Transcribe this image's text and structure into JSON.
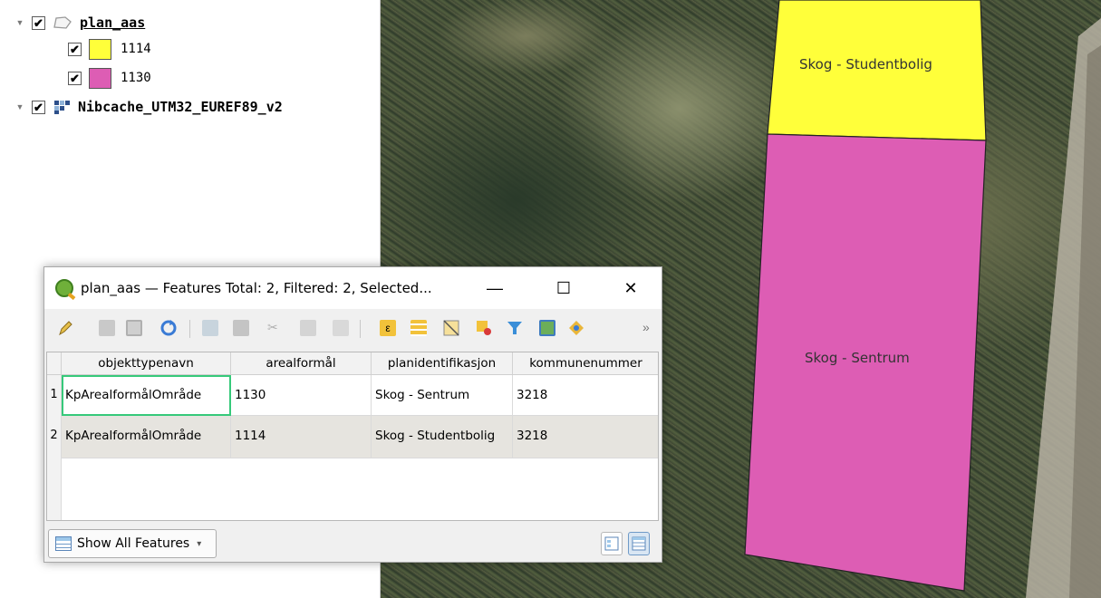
{
  "layers_panel": {
    "layers": [
      {
        "name": "plan_aas",
        "checked": true,
        "icon": "polygon-layer-icon",
        "legend": [
          {
            "label": "1114",
            "color": "#ffff3a",
            "checked": true
          },
          {
            "label": "1130",
            "color": "#dd5db4",
            "checked": true
          }
        ]
      },
      {
        "name": "Nibcache_UTM32_EUREF89_v2",
        "checked": true,
        "icon": "raster-layer-icon"
      }
    ]
  },
  "map": {
    "zones": [
      {
        "label": "Skog - Studentbolig",
        "color": "#ffff3a"
      },
      {
        "label": "Skog - Sentrum",
        "color": "#dd5db4"
      }
    ]
  },
  "attribute_table": {
    "title": "plan_aas — Features Total: 2, Filtered: 2, Selected...",
    "window_controls": {
      "minimize": "—",
      "maximize": "☐",
      "close": "✕"
    },
    "toolbar_overflow": "»",
    "columns": [
      "objekttypenavn",
      "arealformål",
      "planidentifikasjon",
      "kommunenummer"
    ],
    "rows": [
      {
        "num": "1",
        "cells": [
          "KpArealformålOmråde",
          "1130",
          "Skog - Sentrum",
          "3218"
        ]
      },
      {
        "num": "2",
        "cells": [
          "KpArealformålOmråde",
          "1114",
          "Skog - Studentbolig",
          "3218"
        ]
      }
    ],
    "filter_button": {
      "label": "Show All Features",
      "icon": "table-icon"
    }
  }
}
